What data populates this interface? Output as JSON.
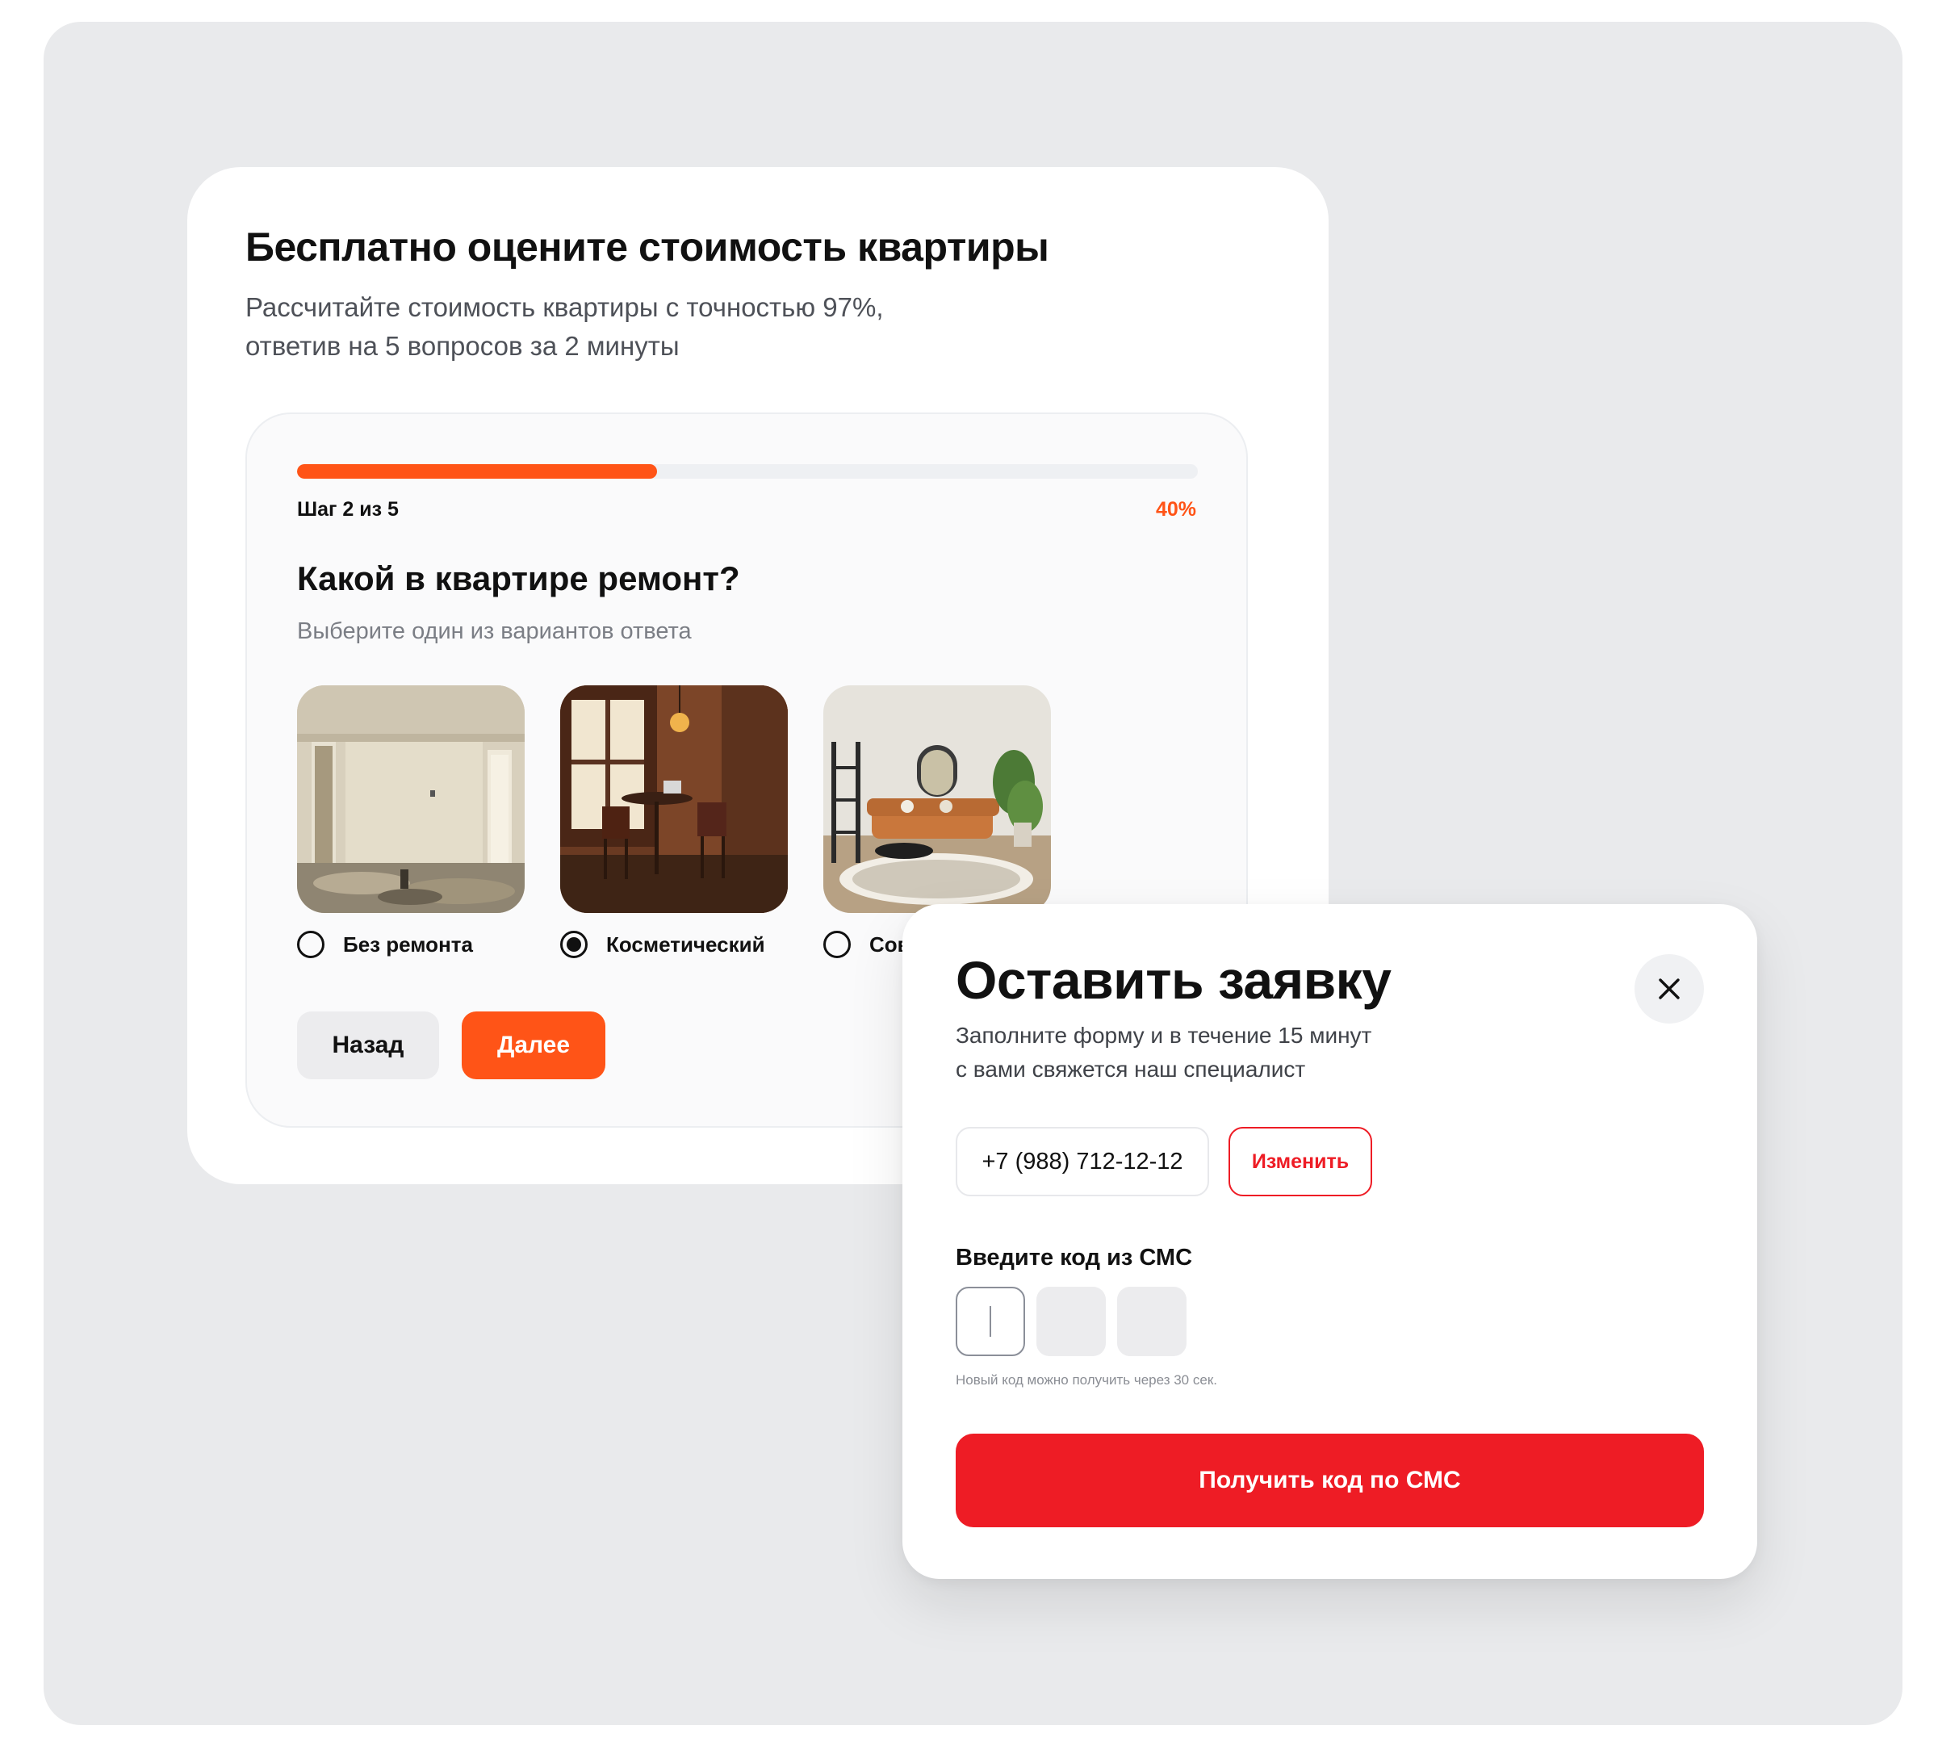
{
  "quiz": {
    "title": "Бесплатно оцените стоимость квартиры",
    "subtitle_line1": "Рассчитайте стоимость квартиры с точностью 97%,",
    "subtitle_line2": "ответив на 5 вопросов за 2 минуты",
    "step_label": "Шаг 2 из 5",
    "progress_percent_label": "40%",
    "progress_fraction": 0.4,
    "question": "Какой в квартире ремонт?",
    "hint": "Выберите один из вариантов ответа",
    "options": [
      {
        "label": "Без ремонта",
        "selected": false
      },
      {
        "label": "Косметический",
        "selected": true
      },
      {
        "label": "Сов",
        "selected": false
      }
    ],
    "back_label": "Назад",
    "next_label": "Далее"
  },
  "modal": {
    "title": "Оставить заявку",
    "subtitle_line1": "Заполните форму и в течение 15 минут",
    "subtitle_line2": "с вами свяжется наш специалист",
    "phone_value": "+7 (988) 712-12-12",
    "change_label": "Изменить",
    "code_label": "Введите код из СМС",
    "resend_note": "Новый код можно получить через 30 сек.",
    "submit_label": "Получить код по СМС"
  },
  "colors": {
    "accent_orange": "#ff5417",
    "accent_red": "#ee1c25",
    "backdrop": "#e9eaec"
  },
  "icons": {
    "close": "close-icon",
    "radio": "radio-icon"
  }
}
